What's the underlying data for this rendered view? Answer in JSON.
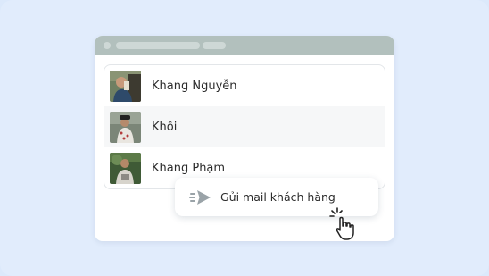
{
  "colors": {
    "background": "#e1ecfc",
    "titlebar": "#b2c0bd",
    "selected_row": "#f6f7f8",
    "text": "#2b2b2b",
    "icon": "#9aa3a8"
  },
  "contacts": [
    {
      "name": "Khang Nguyễn",
      "avatar_icon": "profile-photo"
    },
    {
      "name": "Khôi",
      "avatar_icon": "profile-photo"
    },
    {
      "name": "Khang Phạm",
      "avatar_icon": "profile-photo"
    }
  ],
  "action": {
    "label": "Gửi mail khách hàng",
    "icon": "send-mail-icon"
  },
  "cursor_icon": "pointer-cursor-icon"
}
